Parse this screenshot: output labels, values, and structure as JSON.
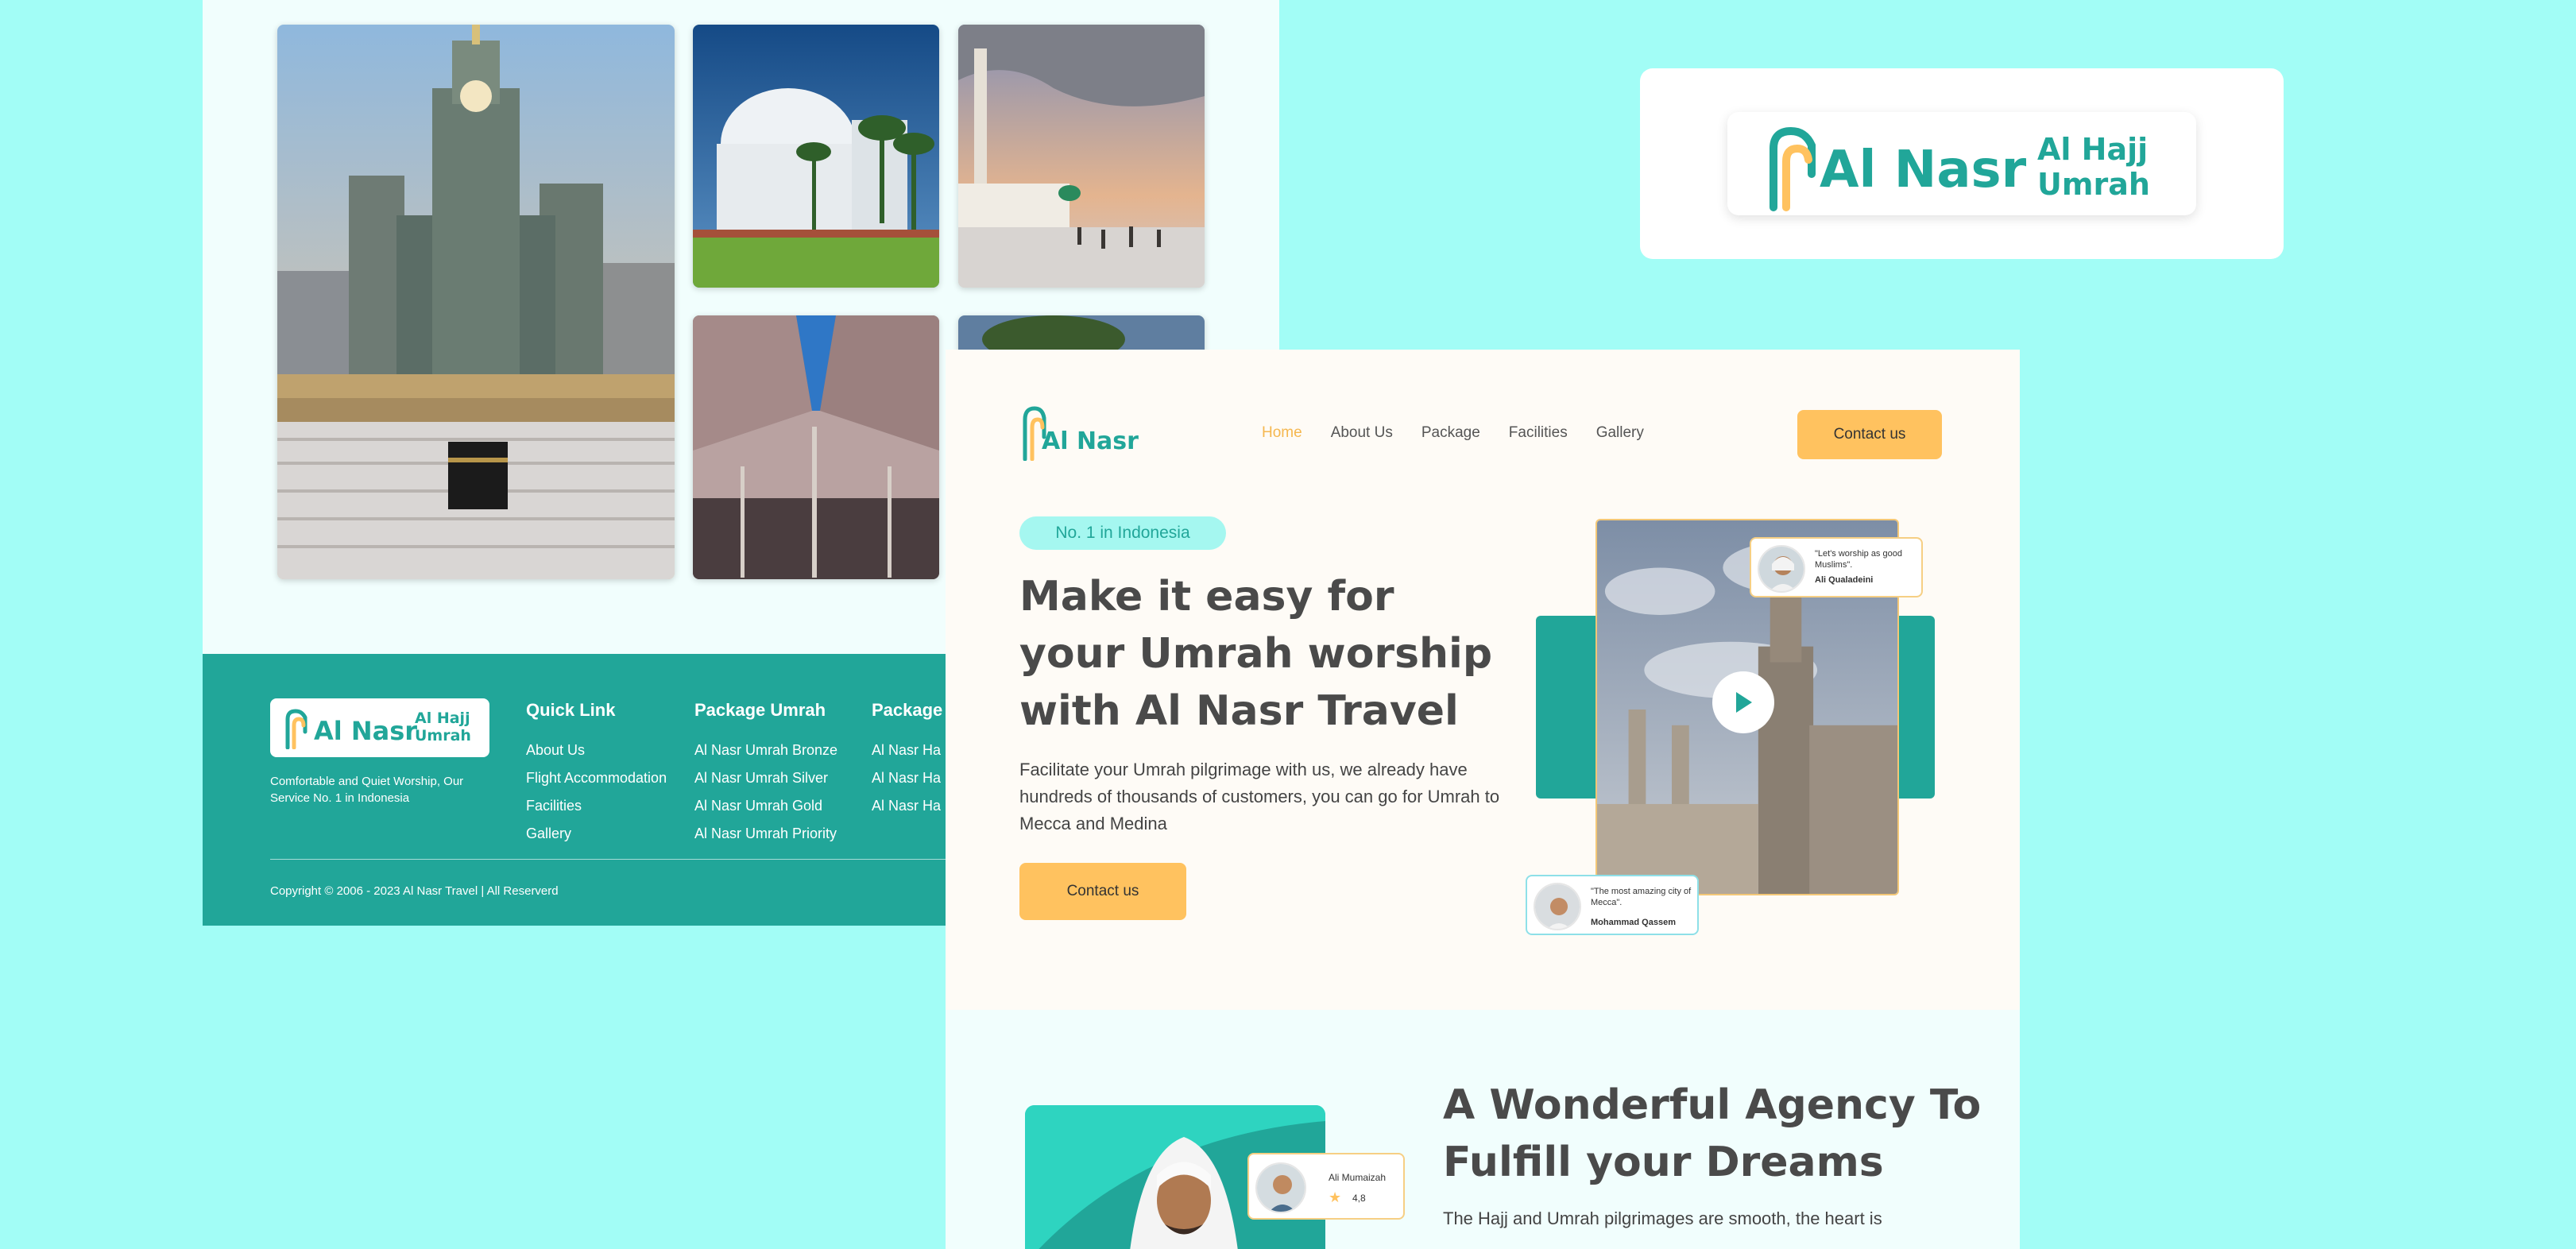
{
  "brand": {
    "name": "Al Nasr",
    "sub_line1": "Al Hajj",
    "sub_line2": "Umrah"
  },
  "colors": {
    "teal": "#21a699",
    "yellow": "#ffc25f",
    "background": "#a2fdf6",
    "badge": "#a5f7f0"
  },
  "gallery": {
    "images": [
      "clock-tower-kaaba-photo",
      "white-mosque-photo",
      "umbrella-courtyard-sunset-photo",
      "umbrella-canopy-photo",
      "palm-trees-photo"
    ]
  },
  "footer": {
    "tagline": "Comfortable and Quiet Worship, Our Service No. 1 in Indonesia",
    "columns": [
      {
        "title": "Quick Link",
        "links": [
          "About Us",
          "Flight Accommodation",
          "Facilities",
          "Gallery"
        ]
      },
      {
        "title": "Package Umrah",
        "links": [
          "Al Nasr Umrah Bronze",
          "Al Nasr Umrah Silver",
          "Al Nasr Umrah Gold",
          "Al Nasr Umrah Priority"
        ]
      },
      {
        "title": "Package",
        "links": [
          "Al Nasr Ha",
          "Al Nasr Ha",
          "Al Nasr Ha"
        ]
      }
    ],
    "copyright": "Copyright © 2006 - 2023 Al Nasr Travel | All Reserverd"
  },
  "nav": {
    "links": [
      "Home",
      "About Us",
      "Package",
      "Facilities",
      "Gallery"
    ],
    "active": "Home",
    "contact_label": "Contact us"
  },
  "hero": {
    "badge": "No. 1 in Indonesia",
    "title": "Make it easy for your Umrah worship with Al Nasr Travel",
    "description": "Facilitate your Umrah pilgrimage with us, we already have hundreds of thousands of customers, you can go for Umrah to Mecca and Medina",
    "contact_label": "Contact us",
    "testimonials": [
      {
        "quote": "\"Let's worship as good Muslims\".",
        "name": "Ali Qualadeini"
      },
      {
        "quote": "\"The most amazing city of Mecca\".",
        "name": "Mohammad Qassem"
      }
    ]
  },
  "about": {
    "title": "A Wonderful Agency To Fulfill your Dreams",
    "description": "The Hajj and Umrah pilgrimages are smooth, the heart is",
    "rating_card": {
      "name": "Ali Mumaizah",
      "rating": "4,8"
    }
  }
}
